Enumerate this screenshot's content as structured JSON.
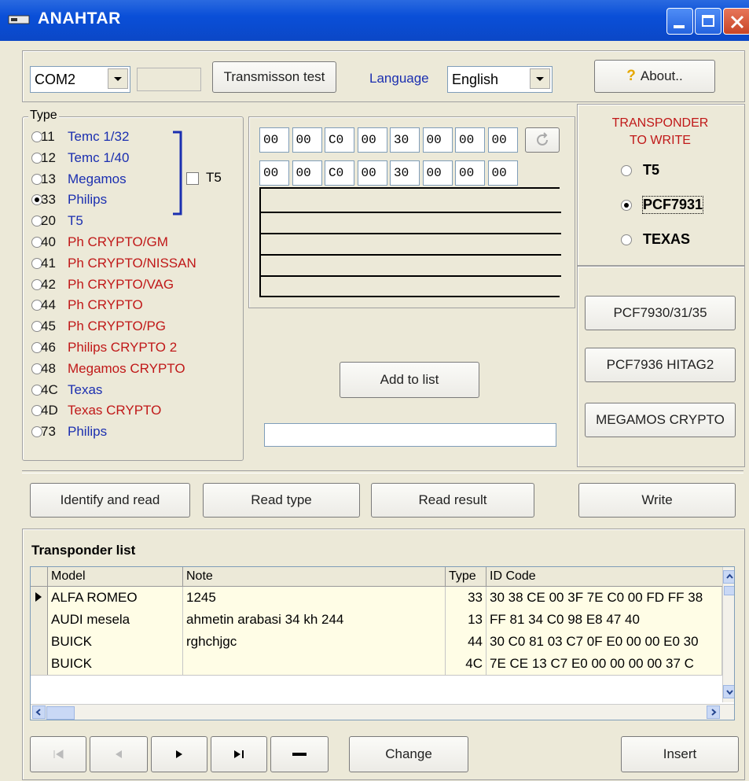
{
  "window": {
    "title": "ANAHTAR"
  },
  "toolbar": {
    "port_value": "COM2",
    "transmission_test_label": "Transmisson test",
    "language_label": "Language",
    "language_value": "English",
    "about_label": "About.."
  },
  "type_group": {
    "label": "Type",
    "t5_checkbox_label": "T5",
    "items": [
      {
        "num": "11",
        "name": "Temc 1/32",
        "color": "blue"
      },
      {
        "num": "12",
        "name": "Temc 1/40",
        "color": "blue"
      },
      {
        "num": "13",
        "name": "Megamos",
        "color": "blue"
      },
      {
        "num": "33",
        "name": "Philips",
        "color": "blue",
        "selected": true
      },
      {
        "num": "20",
        "name": "T5",
        "color": "blue"
      },
      {
        "num": "40",
        "name": "Ph CRYPTO/GM",
        "color": "red"
      },
      {
        "num": "41",
        "name": "Ph CRYPTO/NISSAN",
        "color": "red"
      },
      {
        "num": "42",
        "name": "Ph CRYPTO/VAG",
        "color": "red"
      },
      {
        "num": "44",
        "name": "Ph CRYPTO",
        "color": "red"
      },
      {
        "num": "45",
        "name": "Ph CRYPTO/PG",
        "color": "red"
      },
      {
        "num": "46",
        "name": "Philips CRYPTO 2",
        "color": "red"
      },
      {
        "num": "48",
        "name": "Megamos CRYPTO",
        "color": "red"
      },
      {
        "num": "4C",
        "name": "Texas",
        "color": "blue"
      },
      {
        "num": "4D",
        "name": "Texas CRYPTO",
        "color": "red"
      },
      {
        "num": "73",
        "name": "Philips",
        "color": "blue"
      }
    ]
  },
  "hex": {
    "row1": [
      "00",
      "00",
      "C0",
      "00",
      "30",
      "00",
      "00",
      "00"
    ],
    "row2": [
      "00",
      "00",
      "C0",
      "00",
      "30",
      "00",
      "00",
      "00"
    ]
  },
  "middle": {
    "add_to_list_label": "Add to list",
    "status_value": ""
  },
  "transponder": {
    "title_line1": "TRANSPONDER",
    "title_line2": "TO WRITE",
    "options": [
      "T5",
      "PCF7931",
      "TEXAS"
    ],
    "selected": "PCF7931",
    "btn1": "PCF7930/31/35",
    "btn2": "PCF7936 HITAG2",
    "btn3": "MEGAMOS CRYPTO"
  },
  "actions": {
    "identify_read": "Identify and read",
    "read_type": "Read type",
    "read_result": "Read result",
    "write": "Write"
  },
  "list": {
    "title": "Transponder list",
    "headers": [
      "Model",
      "Note",
      "Type",
      "ID Code"
    ],
    "rows": [
      {
        "model": "ALFA ROMEO",
        "note": "1245",
        "type": "33",
        "id": "30 38 CE 00 3F 7E C0 00 FD FF 38"
      },
      {
        "model": "AUDI mesela",
        "note": "ahmetin arabasi 34 kh 244",
        "type": "13",
        "id": "FF 81 34 C0 98 E8 47 40"
      },
      {
        "model": "BUICK",
        "note": "rghchjgc",
        "type": "44",
        "id": "30 C0 81 03 C7 0F E0 00 00 E0 30"
      },
      {
        "model": "BUICK",
        "note": "",
        "type": "4C",
        "id": "7E CE 13 C7 E0 00 00 00 00 37 C"
      }
    ]
  },
  "navigator": {
    "change_label": "Change",
    "insert_label": "Insert"
  },
  "colors": {
    "title_blue": "#0b47c6",
    "blue_text": "#1b2fb0",
    "red_text": "#c01818",
    "face": "#ece9d8"
  }
}
